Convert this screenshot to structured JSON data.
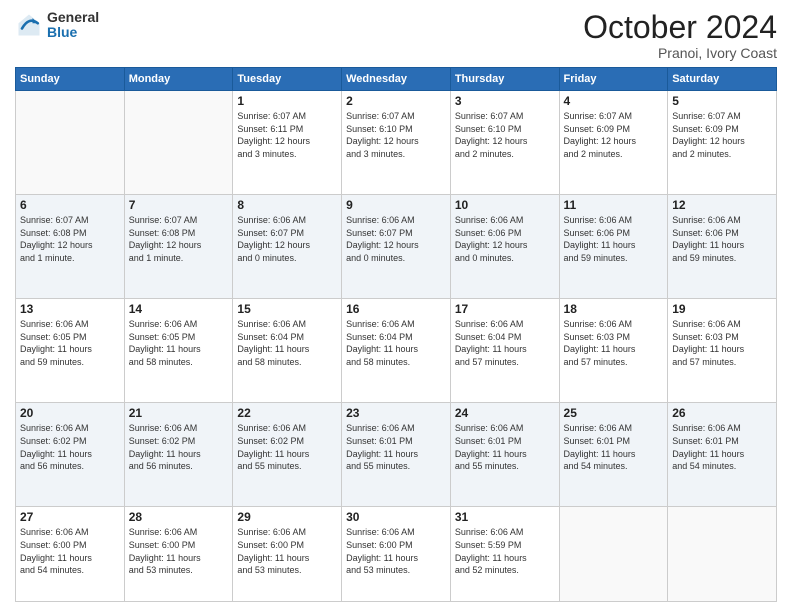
{
  "logo": {
    "general": "General",
    "blue": "Blue"
  },
  "header": {
    "month": "October 2024",
    "location": "Pranoi, Ivory Coast"
  },
  "weekdays": [
    "Sunday",
    "Monday",
    "Tuesday",
    "Wednesday",
    "Thursday",
    "Friday",
    "Saturday"
  ],
  "weeks": [
    [
      {
        "day": "",
        "info": ""
      },
      {
        "day": "",
        "info": ""
      },
      {
        "day": "1",
        "info": "Sunrise: 6:07 AM\nSunset: 6:11 PM\nDaylight: 12 hours\nand 3 minutes."
      },
      {
        "day": "2",
        "info": "Sunrise: 6:07 AM\nSunset: 6:10 PM\nDaylight: 12 hours\nand 3 minutes."
      },
      {
        "day": "3",
        "info": "Sunrise: 6:07 AM\nSunset: 6:10 PM\nDaylight: 12 hours\nand 2 minutes."
      },
      {
        "day": "4",
        "info": "Sunrise: 6:07 AM\nSunset: 6:09 PM\nDaylight: 12 hours\nand 2 minutes."
      },
      {
        "day": "5",
        "info": "Sunrise: 6:07 AM\nSunset: 6:09 PM\nDaylight: 12 hours\nand 2 minutes."
      }
    ],
    [
      {
        "day": "6",
        "info": "Sunrise: 6:07 AM\nSunset: 6:08 PM\nDaylight: 12 hours\nand 1 minute."
      },
      {
        "day": "7",
        "info": "Sunrise: 6:07 AM\nSunset: 6:08 PM\nDaylight: 12 hours\nand 1 minute."
      },
      {
        "day": "8",
        "info": "Sunrise: 6:06 AM\nSunset: 6:07 PM\nDaylight: 12 hours\nand 0 minutes."
      },
      {
        "day": "9",
        "info": "Sunrise: 6:06 AM\nSunset: 6:07 PM\nDaylight: 12 hours\nand 0 minutes."
      },
      {
        "day": "10",
        "info": "Sunrise: 6:06 AM\nSunset: 6:06 PM\nDaylight: 12 hours\nand 0 minutes."
      },
      {
        "day": "11",
        "info": "Sunrise: 6:06 AM\nSunset: 6:06 PM\nDaylight: 11 hours\nand 59 minutes."
      },
      {
        "day": "12",
        "info": "Sunrise: 6:06 AM\nSunset: 6:06 PM\nDaylight: 11 hours\nand 59 minutes."
      }
    ],
    [
      {
        "day": "13",
        "info": "Sunrise: 6:06 AM\nSunset: 6:05 PM\nDaylight: 11 hours\nand 59 minutes."
      },
      {
        "day": "14",
        "info": "Sunrise: 6:06 AM\nSunset: 6:05 PM\nDaylight: 11 hours\nand 58 minutes."
      },
      {
        "day": "15",
        "info": "Sunrise: 6:06 AM\nSunset: 6:04 PM\nDaylight: 11 hours\nand 58 minutes."
      },
      {
        "day": "16",
        "info": "Sunrise: 6:06 AM\nSunset: 6:04 PM\nDaylight: 11 hours\nand 58 minutes."
      },
      {
        "day": "17",
        "info": "Sunrise: 6:06 AM\nSunset: 6:04 PM\nDaylight: 11 hours\nand 57 minutes."
      },
      {
        "day": "18",
        "info": "Sunrise: 6:06 AM\nSunset: 6:03 PM\nDaylight: 11 hours\nand 57 minutes."
      },
      {
        "day": "19",
        "info": "Sunrise: 6:06 AM\nSunset: 6:03 PM\nDaylight: 11 hours\nand 57 minutes."
      }
    ],
    [
      {
        "day": "20",
        "info": "Sunrise: 6:06 AM\nSunset: 6:02 PM\nDaylight: 11 hours\nand 56 minutes."
      },
      {
        "day": "21",
        "info": "Sunrise: 6:06 AM\nSunset: 6:02 PM\nDaylight: 11 hours\nand 56 minutes."
      },
      {
        "day": "22",
        "info": "Sunrise: 6:06 AM\nSunset: 6:02 PM\nDaylight: 11 hours\nand 55 minutes."
      },
      {
        "day": "23",
        "info": "Sunrise: 6:06 AM\nSunset: 6:01 PM\nDaylight: 11 hours\nand 55 minutes."
      },
      {
        "day": "24",
        "info": "Sunrise: 6:06 AM\nSunset: 6:01 PM\nDaylight: 11 hours\nand 55 minutes."
      },
      {
        "day": "25",
        "info": "Sunrise: 6:06 AM\nSunset: 6:01 PM\nDaylight: 11 hours\nand 54 minutes."
      },
      {
        "day": "26",
        "info": "Sunrise: 6:06 AM\nSunset: 6:01 PM\nDaylight: 11 hours\nand 54 minutes."
      }
    ],
    [
      {
        "day": "27",
        "info": "Sunrise: 6:06 AM\nSunset: 6:00 PM\nDaylight: 11 hours\nand 54 minutes."
      },
      {
        "day": "28",
        "info": "Sunrise: 6:06 AM\nSunset: 6:00 PM\nDaylight: 11 hours\nand 53 minutes."
      },
      {
        "day": "29",
        "info": "Sunrise: 6:06 AM\nSunset: 6:00 PM\nDaylight: 11 hours\nand 53 minutes."
      },
      {
        "day": "30",
        "info": "Sunrise: 6:06 AM\nSunset: 6:00 PM\nDaylight: 11 hours\nand 53 minutes."
      },
      {
        "day": "31",
        "info": "Sunrise: 6:06 AM\nSunset: 5:59 PM\nDaylight: 11 hours\nand 52 minutes."
      },
      {
        "day": "",
        "info": ""
      },
      {
        "day": "",
        "info": ""
      }
    ]
  ]
}
